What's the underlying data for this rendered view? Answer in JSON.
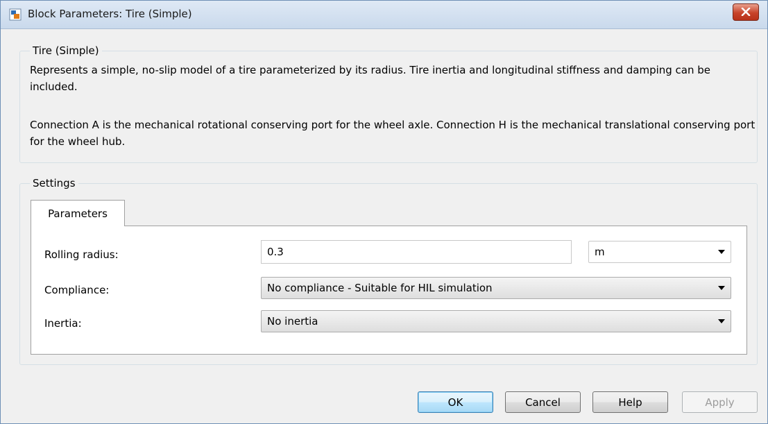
{
  "window": {
    "title": "Block Parameters: Tire (Simple)"
  },
  "description": {
    "legend": "Tire (Simple)",
    "paragraph1": "Represents a simple, no-slip model of a tire parameterized by its radius. Tire inertia and longitudinal stiffness and damping can be included.",
    "paragraph2": "Connection A is the mechanical rotational conserving port for the wheel axle. Connection H is the mechanical translational conserving port for the wheel hub."
  },
  "settings": {
    "legend": "Settings",
    "tabs": [
      {
        "label": "Parameters",
        "selected": true
      }
    ],
    "rows": {
      "rolling_radius": {
        "label": "Rolling radius:",
        "value": "0.3",
        "unit": "m"
      },
      "compliance": {
        "label": "Compliance:",
        "value": "No compliance - Suitable for HIL simulation"
      },
      "inertia": {
        "label": "Inertia:",
        "value": "No inertia"
      }
    }
  },
  "buttons": {
    "ok": "OK",
    "cancel": "Cancel",
    "help": "Help",
    "apply": "Apply"
  },
  "icons": {
    "app": "simulink-block-icon",
    "close": "close-icon"
  },
  "colors": {
    "close_button": "#c7432a",
    "default_button_border": "#3c7fb1",
    "disabled_text": "#9c9c9c"
  }
}
